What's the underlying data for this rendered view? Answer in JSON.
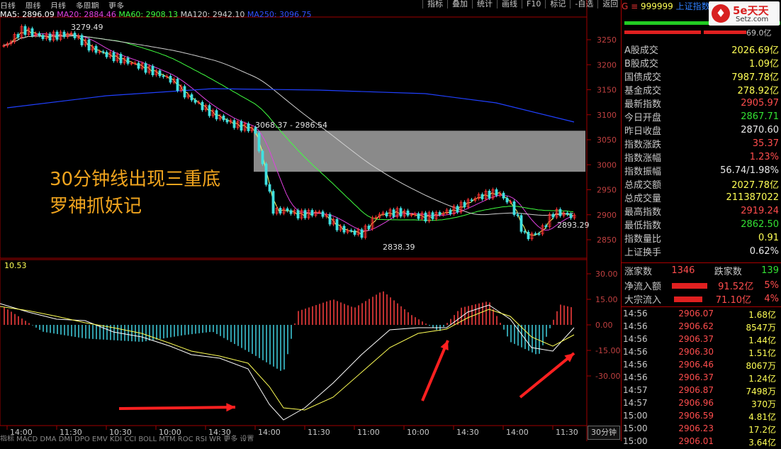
{
  "menu": [
    "日线",
    "周线",
    "月线",
    "多周期",
    "更多"
  ],
  "toolbar": [
    "指标",
    "叠加",
    "统计",
    "画线",
    "F10",
    "标记",
    "-自选",
    "返回"
  ],
  "ma": [
    {
      "label": "MA5: 2896.09",
      "color": "#ffffff"
    },
    {
      "label": "MA20: 2884.46",
      "color": "#e040e0"
    },
    {
      "label": "MA60: 2908.13",
      "color": "#40ff40"
    },
    {
      "label": "MA120: 2942.10",
      "color": "#d0d0d0"
    },
    {
      "label": "MA250: 3096.75",
      "color": "#3050ff"
    }
  ],
  "price_axis": [
    "3250",
    "3200",
    "3150",
    "3100",
    "3050",
    "3000",
    "2950",
    "2900",
    "2850"
  ],
  "macd_axis": [
    "30.00",
    "15.00",
    "0.00",
    "-15.00",
    "-30.00"
  ],
  "macd_value": "10.53",
  "annotations": {
    "high": "3279.49",
    "range": "3068.37 - 2986.54",
    "low": "2838.39",
    "last": "2893.29"
  },
  "headline": [
    "30分钟线出现三重底",
    "罗神抓妖记"
  ],
  "time_axis": [
    "14:00",
    "11:30",
    "10:30",
    "10:00",
    "14:30",
    "14:00",
    "11:30",
    "11:00",
    "10:00",
    "14:30",
    "14:00",
    "11:30"
  ],
  "period_button": "30分钟",
  "bottom_tabs": "指标 MACD DMA DMI DPO EMV KDJ CCI BOLL MTM ROC RSI WR 更多 设置",
  "logo": {
    "big": "5e天天",
    "small": "Setz.com"
  },
  "quote": {
    "code": "999999",
    "name": "上证指数",
    "ratio": "69.0亿",
    "rows": [
      {
        "k": "A股成交",
        "v": "2026.69亿",
        "c": "yellow"
      },
      {
        "k": "B股成交",
        "v": "1.09亿",
        "c": "yellow"
      },
      {
        "k": "国债成交",
        "v": "7987.78亿",
        "c": "yellow"
      },
      {
        "k": "基金成交",
        "v": "278.92亿",
        "c": "yellow"
      },
      {
        "k": "最新指数",
        "v": "2905.97",
        "c": "red"
      },
      {
        "k": "今日开盘",
        "v": "2867.71",
        "c": "green"
      },
      {
        "k": "昨日收盘",
        "v": "2870.60",
        "c": "white"
      },
      {
        "k": "指数涨跌",
        "v": "35.37",
        "c": "red"
      },
      {
        "k": "指数涨幅",
        "v": "1.23%",
        "c": "red"
      },
      {
        "k": "指数振幅",
        "v": "56.74/1.98%",
        "c": "white"
      },
      {
        "k": "总成交额",
        "v": "2027.78亿",
        "c": "yellow"
      },
      {
        "k": "总成交量",
        "v": "211387022",
        "c": "yellow"
      },
      {
        "k": "最高指数",
        "v": "2919.24",
        "c": "red"
      },
      {
        "k": "最低指数",
        "v": "2862.50",
        "c": "green"
      },
      {
        "k": "指数量比",
        "v": "0.91",
        "c": "yellow"
      },
      {
        "k": "上证换手",
        "v": "0.62%",
        "c": "white"
      }
    ],
    "up_label": "涨家数",
    "up": "1346",
    "down_label": "跌家数",
    "down": "139",
    "net_in_label": "净流入额",
    "net_in": "91.52亿",
    "net_in_pct": "5%",
    "block_label": "大宗流入",
    "block": "71.10亿",
    "block_pct": "4%",
    "trades": [
      {
        "t": "14:56",
        "p": "2906.07",
        "v": "1.68亿"
      },
      {
        "t": "14:56",
        "p": "2906.62",
        "v": "8547万"
      },
      {
        "t": "14:56",
        "p": "2906.37",
        "v": "1.44亿"
      },
      {
        "t": "14:56",
        "p": "2906.30",
        "v": "1.51亿"
      },
      {
        "t": "14:56",
        "p": "2906.46",
        "v": "8067万"
      },
      {
        "t": "14:56",
        "p": "2906.37",
        "v": "1.24亿"
      },
      {
        "t": "14:57",
        "p": "2906.87",
        "v": "7498万"
      },
      {
        "t": "14:57",
        "p": "2906.96",
        "v": "370万"
      },
      {
        "t": "15:00",
        "p": "2906.59",
        "v": "4.81亿"
      },
      {
        "t": "15:00",
        "p": "2906.23",
        "v": "17.2亿"
      },
      {
        "t": "15:00",
        "p": "2906.01",
        "v": "3.64亿"
      }
    ]
  }
}
